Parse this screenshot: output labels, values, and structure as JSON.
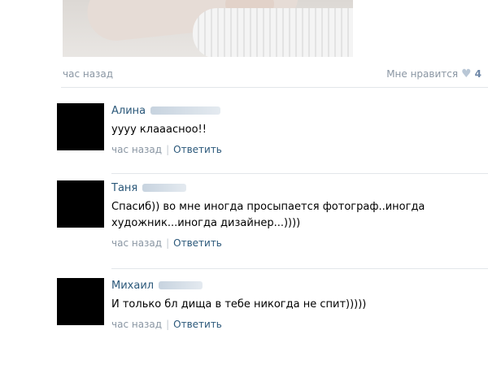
{
  "post": {
    "time": "час назад",
    "like_label": "Мне нравится",
    "like_icon": "heart-icon",
    "like_count": "4"
  },
  "comments": [
    {
      "name": "Алина",
      "text": "уууу клааасноо!!",
      "time": "час назад",
      "separator": "|",
      "reply": "Ответить"
    },
    {
      "name": "Таня",
      "text": "Спасиб)) во мне иногда просыпается фотограф..иногда художник...иногда дизайнер...))))",
      "time": "час назад",
      "separator": "|",
      "reply": "Ответить"
    },
    {
      "name": "Михаил",
      "text": "И только бл дища в тебе никогда не спит)))))",
      "time": "час назад",
      "separator": "|",
      "reply": "Ответить"
    }
  ],
  "colors": {
    "link": "#2b587a",
    "meta": "#8a96a3",
    "divider": "#e2e6ea"
  }
}
